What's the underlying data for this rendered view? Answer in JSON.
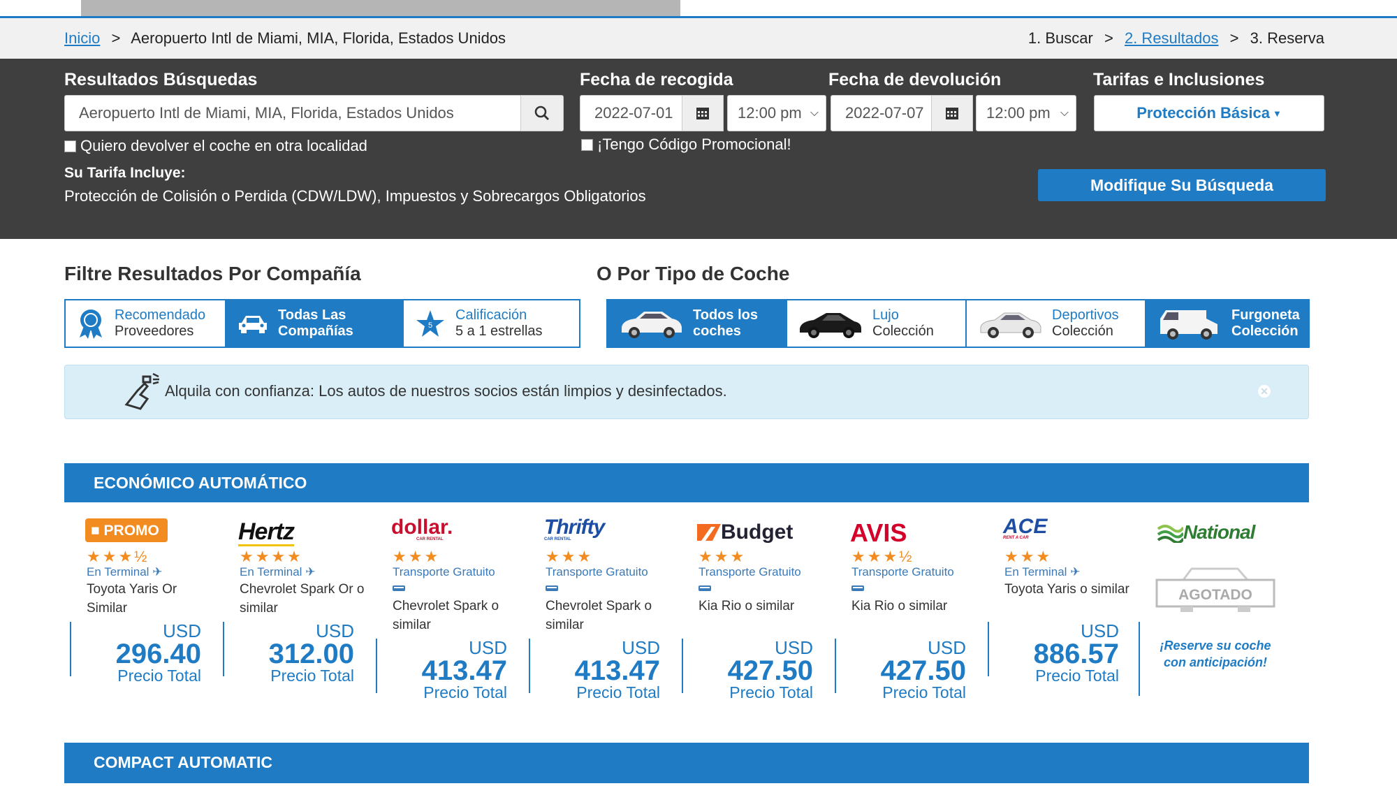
{
  "breadcrumb": {
    "home": "Inicio",
    "sep": ">",
    "location": "Aeropuerto Intl de Miami, MIA, Florida, Estados Unidos"
  },
  "steps": {
    "s1": "1. Buscar",
    "s2": "2. Resultados",
    "s3": "3. Reserva",
    "sep": ">"
  },
  "search": {
    "results_label": "Resultados Búsquedas",
    "location_value": "Aeropuerto Intl de Miami, MIA, Florida, Estados Unidos",
    "return_other_label": "Quiero devolver el coche en otra localidad",
    "pickup_label": "Fecha de recogida",
    "pickup_date": "2022-07-01",
    "pickup_time": "12:00 pm",
    "dropoff_label": "Fecha de devolución",
    "dropoff_date": "2022-07-07",
    "dropoff_time": "12:00 pm",
    "promo_label": "¡Tengo Código Promocional!",
    "rates_label": "Tarifas e Inclusiones",
    "protection_button": "Protección Básica",
    "includes_label": "Su Tarifa Incluye:",
    "includes_text": "Protección de Colisión o Perdida (CDW/LDW), Impuestos y Sobrecargos Obligatorios",
    "modify_button": "Modifique Su Búsqueda"
  },
  "filters": {
    "company_title": "Filtre Resultados Por Compañía",
    "type_title": "O Por Tipo de Coche",
    "company": [
      {
        "line1": "Recomendado",
        "line2": "Proveedores"
      },
      {
        "line1": "Todas Las",
        "line2": "Compañías"
      },
      {
        "line1": "Calificación",
        "line2": "5 a 1 estrellas"
      }
    ],
    "types": [
      {
        "line1": "Todos los",
        "line2": "coches"
      },
      {
        "line1": "Lujo",
        "line2": "Colección"
      },
      {
        "line1": "Deportivos",
        "line2": "Colección"
      },
      {
        "line1": "Furgoneta",
        "line2": "Colección"
      }
    ]
  },
  "notice": {
    "text": "Alquila con confianza: Los autos de nuestros socios están limpios y desinfectados."
  },
  "sections": {
    "economy": "ECONÓMICO AUTOMÁTICO",
    "compact": "COMPACT AUTOMATIC"
  },
  "offers": [
    {
      "brand": "PROMO",
      "stars": "★★★½",
      "transport": "En Terminal",
      "car": "Toyota Yaris Or Similar",
      "currency": "USD",
      "price": "296.40",
      "price_label": "Precio Total"
    },
    {
      "brand": "Hertz",
      "stars": "★★★★",
      "transport": "En Terminal",
      "car": "Chevrolet Spark Or o similar",
      "currency": "USD",
      "price": "312.00",
      "price_label": "Precio Total"
    },
    {
      "brand": "dollar.",
      "sub": "CAR RENTAL",
      "stars": "★★★",
      "transport": "Transporte Gratuito",
      "car": "Chevrolet Spark o similar",
      "currency": "USD",
      "price": "413.47",
      "price_label": "Precio Total"
    },
    {
      "brand": "Thrifty",
      "sub": "CAR RENTAL",
      "stars": "★★★",
      "transport": "Transporte Gratuito",
      "car": "Chevrolet Spark o similar",
      "currency": "USD",
      "price": "413.47",
      "price_label": "Precio Total"
    },
    {
      "brand": "Budget",
      "stars": "★★★",
      "transport": "Transporte Gratuito",
      "car": "Kia Rio o similar",
      "currency": "USD",
      "price": "427.50",
      "price_label": "Precio Total"
    },
    {
      "brand": "AVIS",
      "stars": "★★★½",
      "transport": "Transporte Gratuito",
      "car": "Kia Rio o similar",
      "currency": "USD",
      "price": "427.50",
      "price_label": "Precio Total"
    },
    {
      "brand": "ACE",
      "sub": "RENT A CAR",
      "stars": "★★★",
      "transport": "En Terminal",
      "car": "Toyota Yaris o similar",
      "currency": "USD",
      "price": "886.57",
      "price_label": "Precio Total"
    }
  ],
  "national": {
    "brand": "National",
    "sold_out": "AGOTADO",
    "reserve": "¡Reserve su coche con anticipación!"
  },
  "colors": {
    "accent": "#1e7bc4",
    "dark_panel": "#3f3f3f",
    "stars": "#f28b20",
    "notice_bg": "#d9eef7"
  }
}
